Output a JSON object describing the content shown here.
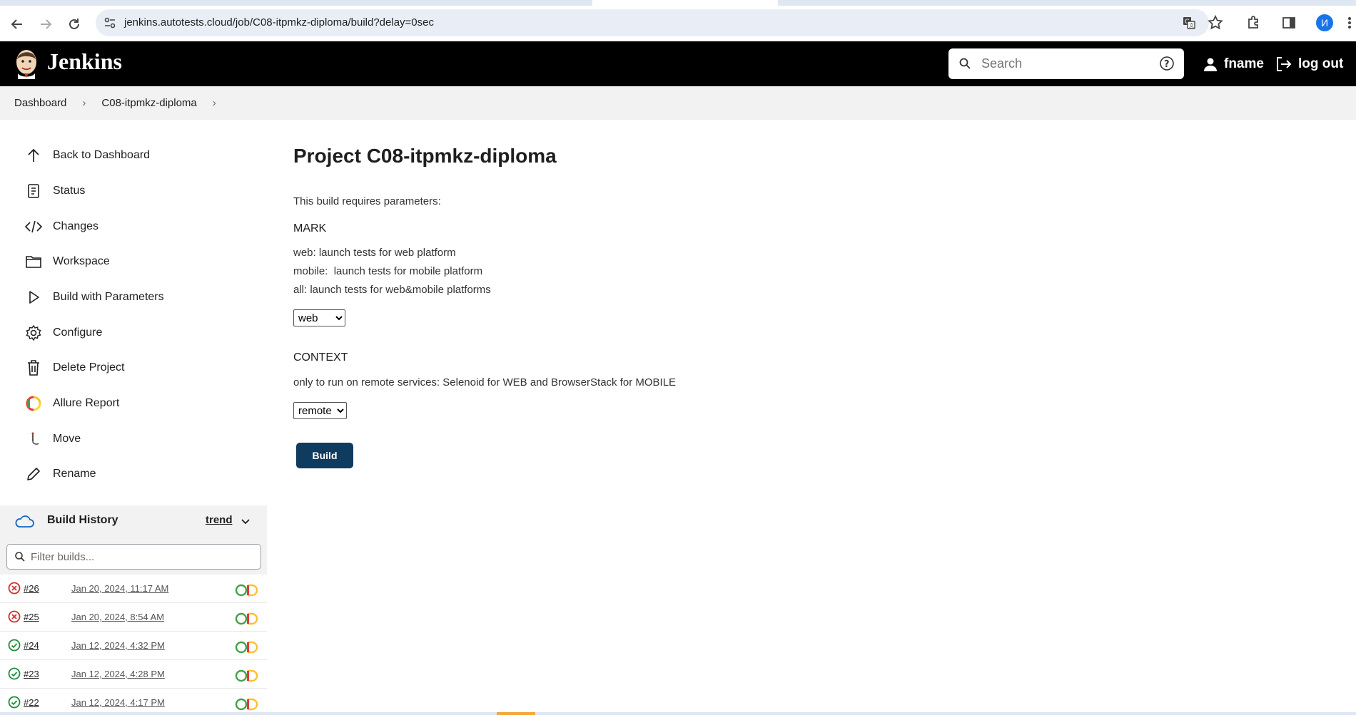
{
  "browser": {
    "url": "jenkins.autotests.cloud/job/C08-itpmkz-diploma/build?delay=0sec",
    "profile_initial": "И"
  },
  "header": {
    "title": "Jenkins",
    "search_placeholder": "Search",
    "user_name": "fname",
    "logout_label": "log out"
  },
  "breadcrumb": {
    "items": [
      "Dashboard",
      "C08-itpmkz-diploma"
    ]
  },
  "sidebar": {
    "items": [
      {
        "label": "Back to Dashboard",
        "icon": "arrow-up-icon"
      },
      {
        "label": "Status",
        "icon": "document-icon"
      },
      {
        "label": "Changes",
        "icon": "code-icon"
      },
      {
        "label": "Workspace",
        "icon": "folder-icon"
      },
      {
        "label": "Build with Parameters",
        "icon": "play-icon"
      },
      {
        "label": "Configure",
        "icon": "gear-icon"
      },
      {
        "label": "Delete Project",
        "icon": "trash-icon"
      },
      {
        "label": "Allure Report",
        "icon": "allure-icon"
      },
      {
        "label": "Move",
        "icon": "move-icon"
      },
      {
        "label": "Rename",
        "icon": "pencil-icon"
      }
    ]
  },
  "build_history": {
    "title": "Build History",
    "trend_label": "trend",
    "filter_placeholder": "Filter builds...",
    "builds": [
      {
        "number": "#26",
        "date": "Jan 20, 2024, 11:17 AM",
        "status": "failed"
      },
      {
        "number": "#25",
        "date": "Jan 20, 2024, 8:54 AM",
        "status": "failed"
      },
      {
        "number": "#24",
        "date": "Jan 12, 2024, 4:32 PM",
        "status": "success"
      },
      {
        "number": "#23",
        "date": "Jan 12, 2024, 4:28 PM",
        "status": "success"
      },
      {
        "number": "#22",
        "date": "Jan 12, 2024, 4:17 PM",
        "status": "success"
      }
    ]
  },
  "main": {
    "title": "Project C08-itpmkz-diploma",
    "requires_text": "This build requires parameters:",
    "params": [
      {
        "name": "MARK",
        "descriptions": [
          "web: launch tests for web platform",
          "mobile:  launch tests for mobile platform",
          "all: launch tests for web&mobile platforms"
        ],
        "selected": "web"
      },
      {
        "name": "CONTEXT",
        "descriptions": [
          "only to run on remote services: Selenoid for WEB and BrowserStack for MOBILE"
        ],
        "selected": "remote"
      }
    ],
    "build_label": "Build"
  },
  "colors": {
    "header_bg": "#000000",
    "build_button": "#0f3b5f",
    "failed": "#d32f2f",
    "success": "#1e8e3e"
  }
}
